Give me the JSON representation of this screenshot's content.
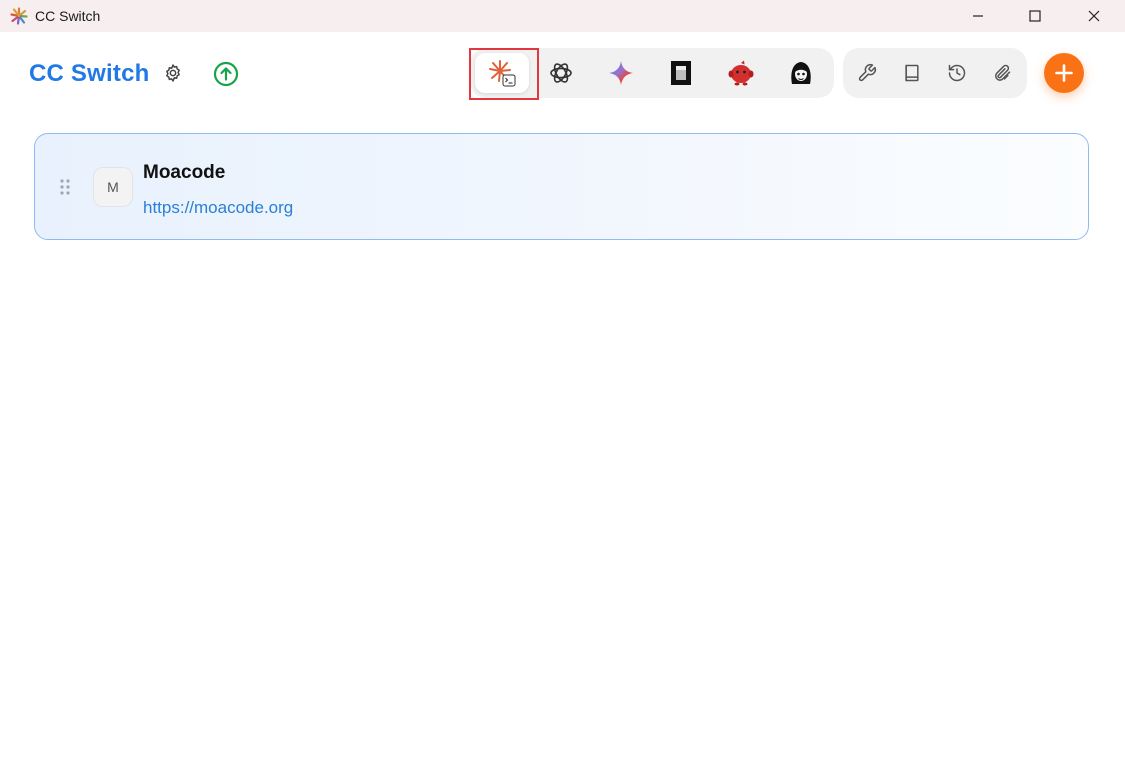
{
  "window": {
    "title": "CC Switch",
    "controls": [
      "minimize",
      "maximize",
      "close"
    ]
  },
  "header": {
    "app_title": "CC Switch",
    "settings_icon": "gear-icon",
    "update_icon": "arrow-up-circle-icon"
  },
  "app_switcher": {
    "active": "claude",
    "apps": [
      {
        "id": "claude",
        "icon": "claude-code-icon"
      },
      {
        "id": "codex",
        "icon": "openai-icon"
      },
      {
        "id": "gemini",
        "icon": "gemini-icon"
      },
      {
        "id": "opencode",
        "icon": "opencode-icon"
      },
      {
        "id": "app5",
        "icon": "red-mascot-icon"
      },
      {
        "id": "app6",
        "icon": "character-icon"
      }
    ]
  },
  "tools": [
    {
      "id": "tools",
      "icon": "wrench-icon"
    },
    {
      "id": "docs",
      "icon": "book-icon"
    },
    {
      "id": "history",
      "icon": "history-icon"
    },
    {
      "id": "attach",
      "icon": "paperclip-icon"
    }
  ],
  "add_button": {
    "icon": "plus-icon"
  },
  "providers": [
    {
      "avatar": "M",
      "name": "Moacode",
      "url": "https://moacode.org"
    }
  ],
  "colors": {
    "accent": "#2179e6",
    "add_button": "#f97316",
    "update": "#16a34a",
    "highlight": "#e0383e"
  }
}
